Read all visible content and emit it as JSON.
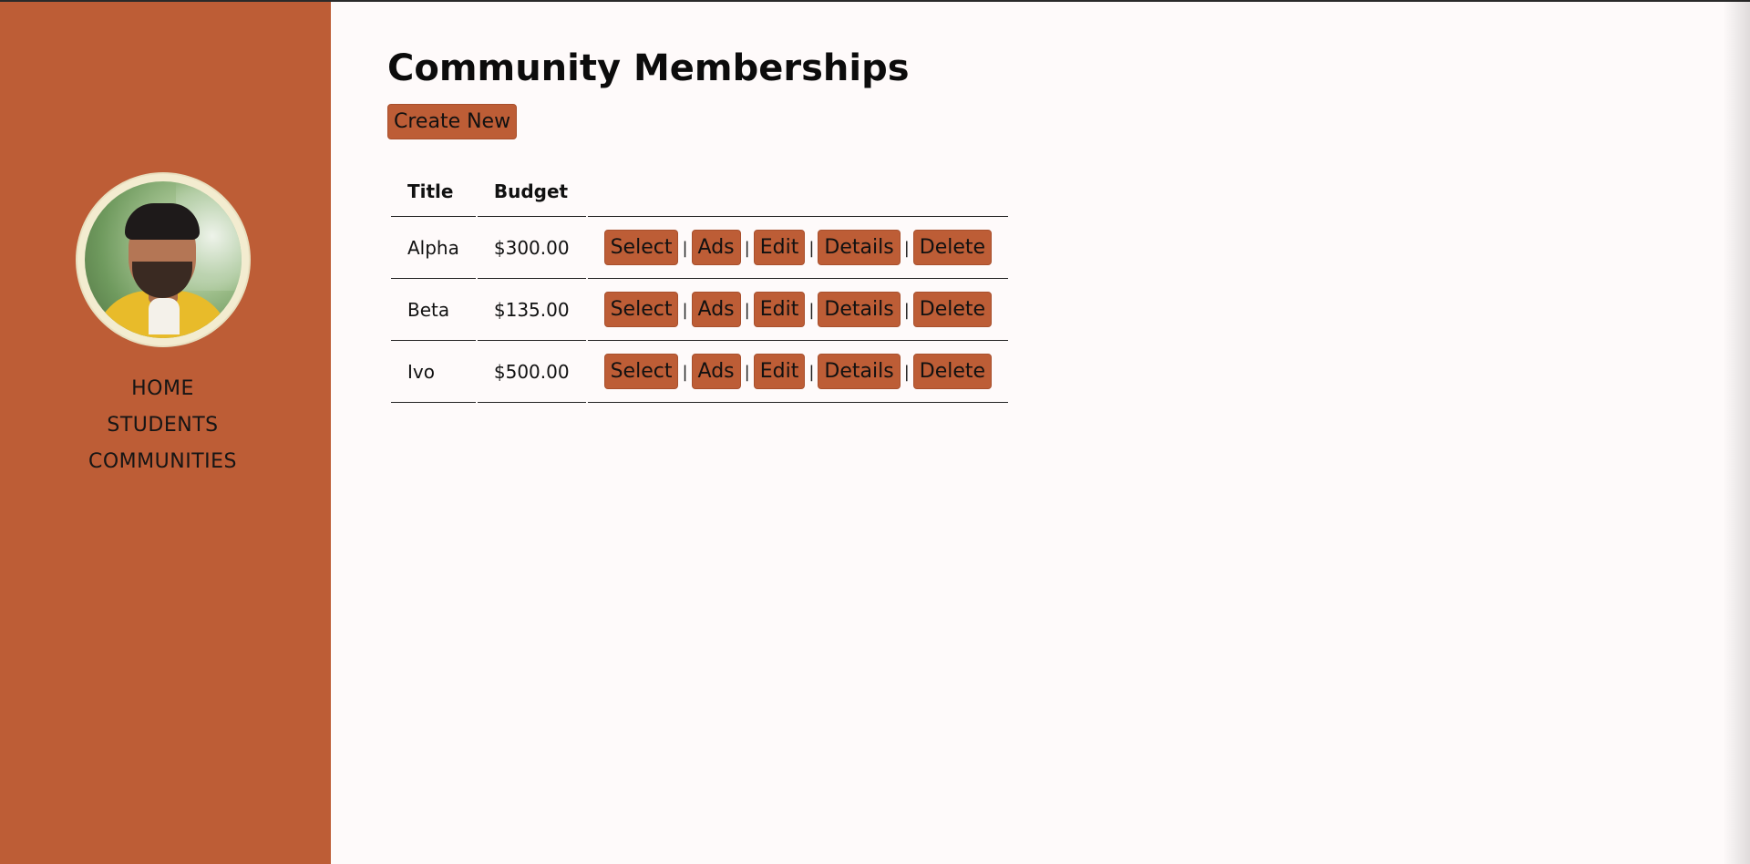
{
  "sidebar": {
    "nav": [
      {
        "label": "HOME"
      },
      {
        "label": "STUDENTS"
      },
      {
        "label": "COMMUNITIES"
      }
    ]
  },
  "main": {
    "title": "Community Memberships",
    "create_label": "Create New",
    "table": {
      "headers": [
        "Title",
        "Budget",
        ""
      ],
      "rows": [
        {
          "title": "Alpha",
          "budget": "$300.00"
        },
        {
          "title": "Beta",
          "budget": "$135.00"
        },
        {
          "title": "Ivo",
          "budget": "$500.00"
        }
      ],
      "actions": [
        "Select",
        "Ads",
        "Edit",
        "Details",
        "Delete"
      ],
      "separator": "|"
    }
  },
  "colors": {
    "accent": "#bd5d36",
    "background": "#fefafa",
    "text": "#111111"
  }
}
